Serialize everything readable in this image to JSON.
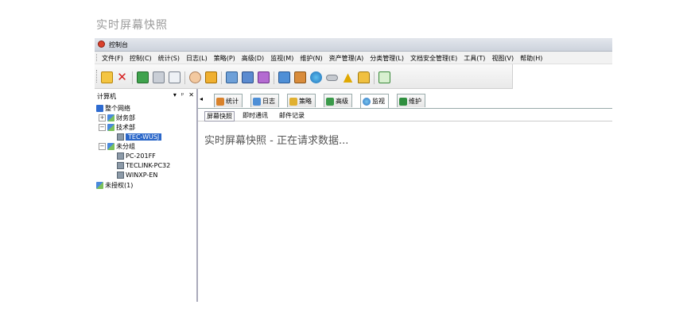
{
  "caption": "实时屏幕快照",
  "window": {
    "title": "控制台"
  },
  "menu": [
    "文件(F)",
    "控制(C)",
    "统计(S)",
    "日志(L)",
    "策略(P)",
    "高级(D)",
    "监视(M)",
    "维护(N)",
    "资产管理(A)",
    "分类管理(L)",
    "文档安全管理(E)",
    "工具(T)",
    "视图(V)",
    "帮助(H)"
  ],
  "toolbar_icons": [
    "new-icon",
    "delete-icon",
    "refresh-icon",
    "print-icon",
    "print-preview-icon",
    "hand-icon",
    "policy-icon",
    "computers-icon",
    "screen-icon",
    "log-icon",
    "network-icon",
    "report-icon",
    "globe-icon",
    "device-icon",
    "warning-icon",
    "lock-icon",
    "update-icon"
  ],
  "left_panel": {
    "title": "计算机",
    "controls": [
      "▾",
      "ᵖ",
      "✕"
    ],
    "tree": {
      "root": "整个网络",
      "group_finance": "财务部",
      "group_tech": "技术部",
      "pc_selected": "TEC-WUSJ",
      "group_ungrouped": "未分组",
      "pc1": "PC-201FF",
      "pc2": "TECLINK-PC32",
      "pc3": "WINXP-EN",
      "unauthorized": "未授权(1)"
    }
  },
  "tabs": {
    "scroll": "◂",
    "items": [
      "统计",
      "日志",
      "策略",
      "高级",
      "监视",
      "维护"
    ]
  },
  "subtabs": [
    "屏幕快照",
    "即时通讯",
    "邮件记录"
  ],
  "status_message": "实时屏幕快照 - 正在请求数据..."
}
